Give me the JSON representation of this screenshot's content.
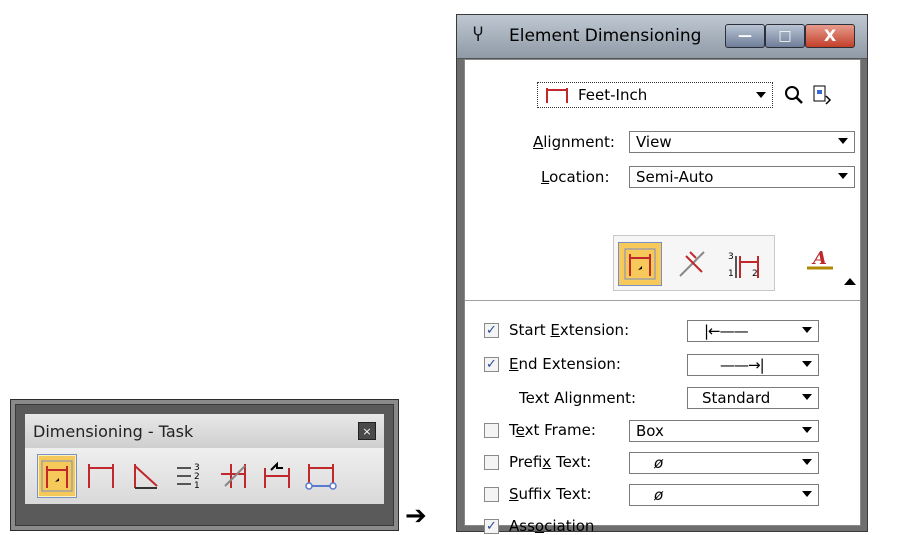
{
  "task_toolbar": {
    "title": "Dimensioning - Task",
    "close_glyph": "×",
    "tools": [
      {
        "icon": "dimension-element-icon",
        "active": true
      },
      {
        "icon": "linear-size-icon",
        "active": false
      },
      {
        "icon": "angle-size-icon",
        "active": false
      },
      {
        "icon": "ordinate-icon",
        "active": false
      },
      {
        "icon": "dimension-spacing-icon",
        "active": false
      },
      {
        "icon": "change-dimension-icon",
        "active": false
      },
      {
        "icon": "dimension-size-icon",
        "active": false
      }
    ]
  },
  "arrow": "➔",
  "element_dimensioning": {
    "title": "Element Dimensioning",
    "window_buttons": {
      "minimize": "—",
      "maximize": "□",
      "close": "X"
    },
    "style_combo": {
      "value": "Feet-Inch"
    },
    "alignment": {
      "label_pre": "",
      "label_u": "A",
      "label_post": "lignment:",
      "value": "View"
    },
    "location": {
      "label_u": "L",
      "label_post": "ocation:",
      "value": "Semi-Auto"
    },
    "options": [
      {
        "pre": "Start ",
        "u": "E",
        "post": "xtension:",
        "checked": true,
        "value": "|←——"
      },
      {
        "pre": "",
        "u": "E",
        "post": "nd Extension:",
        "checked": true,
        "value": "——→|"
      },
      {
        "pre": "Text Alignment:",
        "u": "",
        "post": "",
        "checked": null,
        "value": "Standard"
      },
      {
        "pre": "T",
        "u": "e",
        "post": "xt Frame:",
        "checked": false,
        "value": "Box"
      },
      {
        "pre": "Prefi",
        "u": "x",
        "post": " Text:",
        "checked": false,
        "value": "ø"
      },
      {
        "pre": "",
        "u": "S",
        "post": "uffix Text:",
        "checked": false,
        "value": "ø"
      },
      {
        "pre": "Ass",
        "u": "o",
        "post": "ciation",
        "checked": true,
        "value": ""
      }
    ],
    "check_glyph": "✓",
    "colors": {
      "accent": "#f7c95b",
      "arrow_red": "#c0282c"
    }
  }
}
